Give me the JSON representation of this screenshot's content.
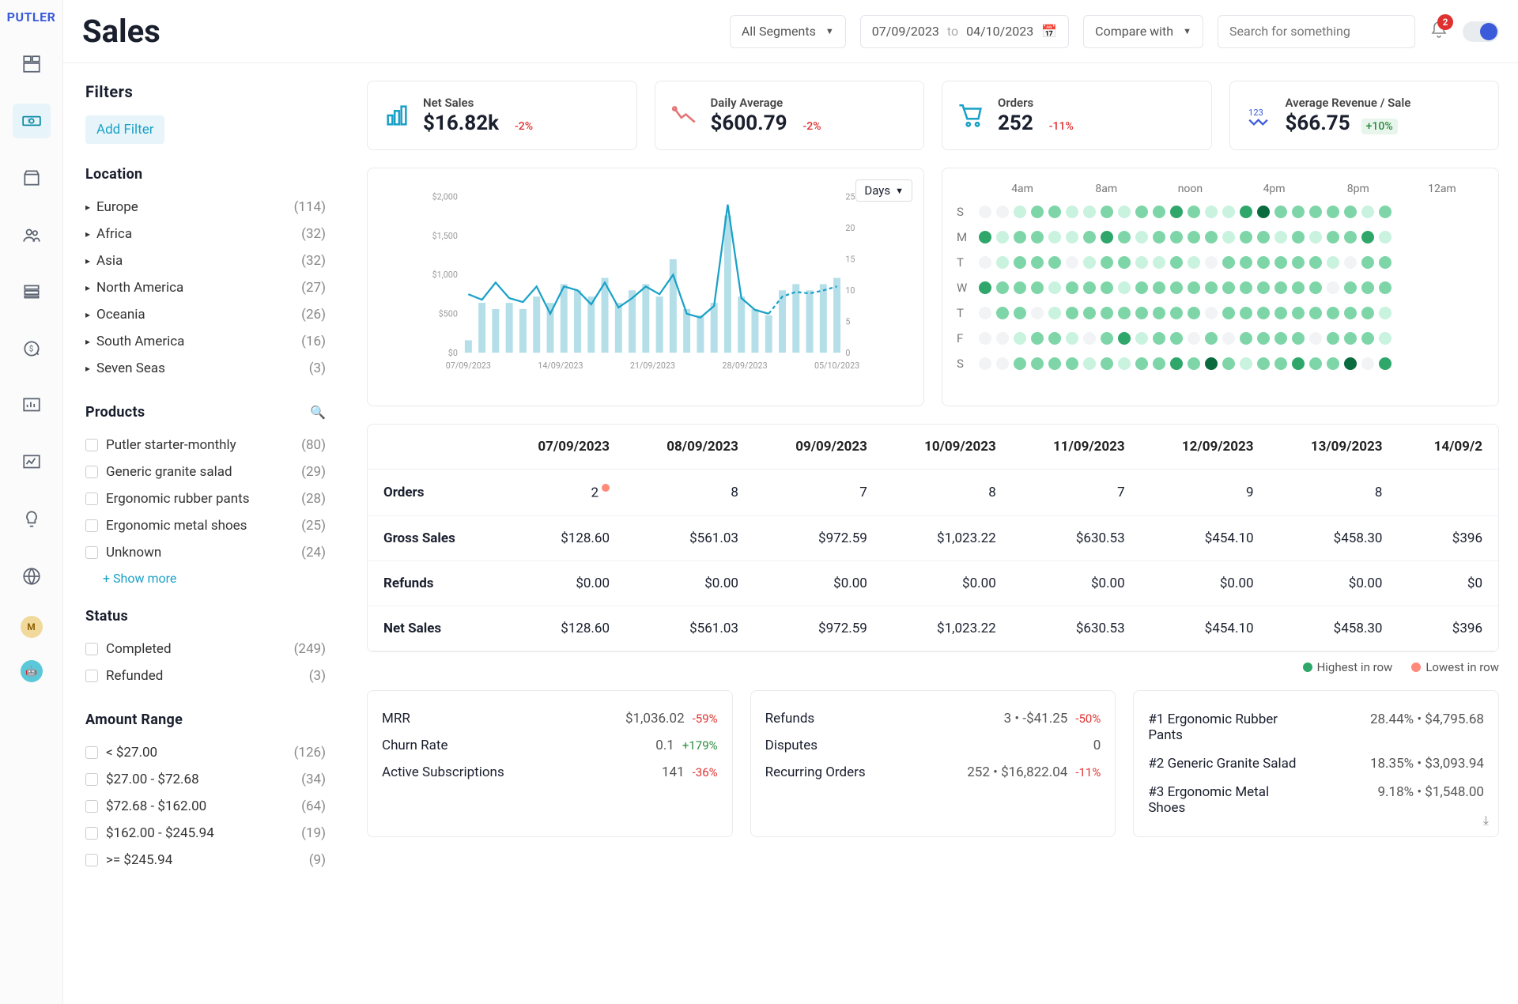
{
  "brand": "PUTLER",
  "page_title": "Sales",
  "topbar": {
    "segments_label": "All Segments",
    "date_from": "07/09/2023",
    "date_to_word": "to",
    "date_to": "04/10/2023",
    "compare_label": "Compare with",
    "search_placeholder": "Search for something",
    "notif_count": "2"
  },
  "filters": {
    "title": "Filters",
    "add_filter": "Add Filter",
    "location_title": "Location",
    "locations": [
      {
        "name": "Europe",
        "count": "(114)"
      },
      {
        "name": "Africa",
        "count": "(32)"
      },
      {
        "name": "Asia",
        "count": "(32)"
      },
      {
        "name": "North America",
        "count": "(27)"
      },
      {
        "name": "Oceania",
        "count": "(26)"
      },
      {
        "name": "South America",
        "count": "(16)"
      },
      {
        "name": "Seven Seas",
        "count": "(3)"
      }
    ],
    "products_title": "Products",
    "products": [
      {
        "name": "Putler starter-monthly",
        "count": "(80)"
      },
      {
        "name": "Generic granite salad",
        "count": "(29)"
      },
      {
        "name": "Ergonomic rubber pants",
        "count": "(28)"
      },
      {
        "name": "Ergonomic metal shoes",
        "count": "(25)"
      },
      {
        "name": "Unknown",
        "count": "(24)"
      }
    ],
    "show_more": "+ Show more",
    "status_title": "Status",
    "statuses": [
      {
        "name": "Completed",
        "count": "(249)"
      },
      {
        "name": "Refunded",
        "count": "(3)"
      }
    ],
    "amount_title": "Amount Range",
    "amounts": [
      {
        "name": "< $27.00",
        "count": "(126)"
      },
      {
        "name": "$27.00 - $72.68",
        "count": "(34)"
      },
      {
        "name": "$72.68 - $162.00",
        "count": "(64)"
      },
      {
        "name": "$162.00 - $245.94",
        "count": "(19)"
      },
      {
        "name": ">= $245.94",
        "count": "(9)"
      }
    ]
  },
  "kpis": [
    {
      "label": "Net Sales",
      "value": "$16.82k",
      "delta": "-2%",
      "dir": "neg",
      "icon": "bar"
    },
    {
      "label": "Daily Average",
      "value": "$600.79",
      "delta": "-2%",
      "dir": "neg",
      "icon": "trend"
    },
    {
      "label": "Orders",
      "value": "252",
      "delta": "-11%",
      "dir": "neg",
      "icon": "cart"
    },
    {
      "label": "Average Revenue / Sale",
      "value": "$66.75",
      "delta": "+10%",
      "dir": "pos",
      "icon": "num"
    }
  ],
  "chart_data": {
    "line": {
      "type": "line+bar",
      "x_labels": [
        "07/09/2023",
        "14/09/2023",
        "21/09/2023",
        "28/09/2023",
        "05/10/2023"
      ],
      "y_left_ticks": [
        "$0",
        "$500",
        "$1,000",
        "$1,500",
        "$2,000"
      ],
      "y_right_ticks": [
        "0",
        "5",
        "10",
        "15",
        "20",
        "25"
      ],
      "line_values": [
        750,
        680,
        900,
        700,
        650,
        850,
        500,
        850,
        800,
        620,
        900,
        580,
        700,
        850,
        750,
        1000,
        500,
        450,
        600,
        1900,
        700,
        550,
        500,
        720,
        780,
        760,
        800,
        850
      ],
      "bar_values": [
        2,
        8,
        7,
        8,
        7,
        9,
        8,
        11,
        10,
        9,
        12,
        8,
        10,
        11,
        9,
        15,
        7,
        6,
        8,
        22,
        9,
        7,
        6,
        10,
        11,
        10,
        11,
        12
      ],
      "selector": "Days"
    },
    "heatmap": {
      "type": "heatmap",
      "col_headers": [
        "4am",
        "8am",
        "noon",
        "4pm",
        "8pm",
        "12am"
      ],
      "row_headers": [
        "S",
        "M",
        "T",
        "W",
        "T",
        "F",
        "S"
      ],
      "palette": [
        "#f1f3f5",
        "#c9f2df",
        "#7ed6a8",
        "#2fa76a",
        "#0a6b3e"
      ],
      "grid": [
        [
          0,
          0,
          1,
          2,
          2,
          1,
          1,
          2,
          1,
          2,
          2,
          3,
          2,
          1,
          1,
          3,
          4,
          2,
          2,
          2,
          2,
          2,
          1,
          2
        ],
        [
          3,
          1,
          2,
          2,
          1,
          1,
          2,
          3,
          2,
          1,
          2,
          2,
          2,
          2,
          1,
          2,
          2,
          1,
          2,
          1,
          2,
          2,
          3,
          1
        ],
        [
          0,
          1,
          2,
          2,
          2,
          0,
          1,
          2,
          2,
          1,
          1,
          2,
          1,
          0,
          2,
          2,
          2,
          2,
          2,
          2,
          1,
          0,
          2,
          2
        ],
        [
          3,
          2,
          2,
          2,
          1,
          2,
          2,
          2,
          1,
          2,
          2,
          2,
          2,
          2,
          2,
          2,
          2,
          2,
          2,
          2,
          0,
          2,
          2,
          2
        ],
        [
          0,
          2,
          2,
          0,
          1,
          2,
          2,
          2,
          2,
          2,
          2,
          2,
          2,
          0,
          2,
          2,
          2,
          2,
          2,
          2,
          2,
          2,
          2,
          1
        ],
        [
          0,
          0,
          1,
          2,
          2,
          1,
          0,
          2,
          3,
          1,
          2,
          2,
          0,
          2,
          0,
          2,
          2,
          2,
          2,
          0,
          2,
          2,
          2,
          1
        ],
        [
          0,
          0,
          2,
          2,
          2,
          2,
          1,
          2,
          1,
          2,
          2,
          3,
          2,
          4,
          2,
          1,
          2,
          2,
          3,
          2,
          2,
          4,
          0,
          3
        ]
      ]
    }
  },
  "table": {
    "headers": [
      "",
      "07/09/2023",
      "08/09/2023",
      "09/09/2023",
      "10/09/2023",
      "11/09/2023",
      "12/09/2023",
      "13/09/2023",
      "14/09/2"
    ],
    "rows": [
      {
        "label": "Orders",
        "vals": [
          "2",
          "8",
          "7",
          "8",
          "7",
          "9",
          "8",
          ""
        ],
        "low_col": 0
      },
      {
        "label": "Gross Sales",
        "vals": [
          "$128.60",
          "$561.03",
          "$972.59",
          "$1,023.22",
          "$630.53",
          "$454.10",
          "$458.30",
          "$396"
        ]
      },
      {
        "label": "Refunds",
        "vals": [
          "$0.00",
          "$0.00",
          "$0.00",
          "$0.00",
          "$0.00",
          "$0.00",
          "$0.00",
          "$0"
        ]
      },
      {
        "label": "Net Sales",
        "vals": [
          "$128.60",
          "$561.03",
          "$972.59",
          "$1,023.22",
          "$630.53",
          "$454.10",
          "$458.30",
          "$396"
        ]
      }
    ]
  },
  "legend": {
    "high": "Highest in row",
    "low": "Lowest in row"
  },
  "bottom": {
    "left": [
      {
        "name": "MRR",
        "val": "$1,036.02",
        "delta": "-59%",
        "dir": "neg"
      },
      {
        "name": "Churn Rate",
        "val": "0.1",
        "delta": "+179%",
        "dir": "pos"
      },
      {
        "name": "Active Subscriptions",
        "val": "141",
        "delta": "-36%",
        "dir": "neg"
      }
    ],
    "mid": [
      {
        "name": "Refunds",
        "val": "3 • -$41.25",
        "delta": "-50%",
        "dir": "neg"
      },
      {
        "name": "Disputes",
        "val": "0",
        "delta": "",
        "dir": ""
      },
      {
        "name": "Recurring Orders",
        "val": "252 • $16,822.04",
        "delta": "-11%",
        "dir": "neg"
      }
    ],
    "right": [
      {
        "name": "#1 Ergonomic Rubber Pants",
        "val": "28.44% • $4,795.68"
      },
      {
        "name": "#2 Generic Granite Salad",
        "val": "18.35% • $3,093.94"
      },
      {
        "name": "#3 Ergonomic Metal Shoes",
        "val": "9.18% • $1,548.00"
      }
    ]
  }
}
